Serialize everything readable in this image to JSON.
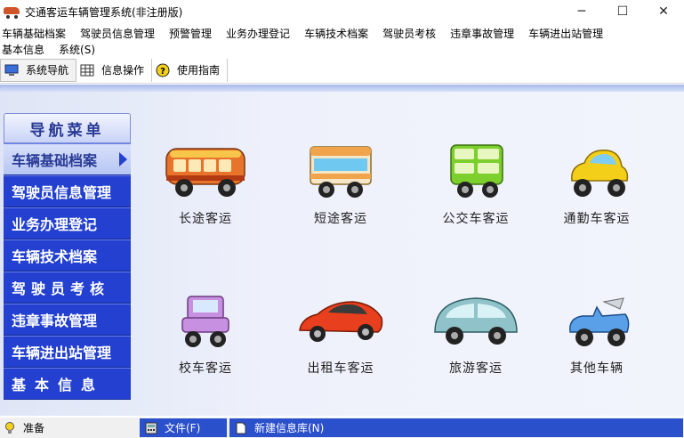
{
  "window": {
    "title": "交通客运车辆管理系统(非注册版)",
    "minimize": "─",
    "maximize": "☐",
    "close": "✕"
  },
  "menu": {
    "row1": [
      "车辆基础档案",
      "驾驶员信息管理",
      "预警管理",
      "业务办理登记",
      "车辆技术档案",
      "驾驶员考核",
      "违章事故管理",
      "车辆进出站管理"
    ],
    "row2": [
      "基本信息",
      "系统(S)"
    ]
  },
  "toolbar": {
    "nav": "系统导航",
    "info": "信息操作",
    "guide": "使用指南"
  },
  "nav": {
    "header": "导航菜单",
    "items": [
      "车辆基础档案",
      "驾驶员信息管理",
      "业务办理登记",
      "车辆技术档案",
      "驾驶员考核",
      "违章事故管理",
      "车辆进出站管理",
      "基本信息"
    ]
  },
  "vehicles": [
    {
      "label": "长途客运",
      "icon": "long-distance-bus-icon",
      "color": "#e8732a"
    },
    {
      "label": "短途客运",
      "icon": "short-distance-bus-icon",
      "color": "#f0a54c"
    },
    {
      "label": "公交车客运",
      "icon": "city-bus-icon",
      "color": "#7ccf2c"
    },
    {
      "label": "通勤车客运",
      "icon": "commuter-car-icon",
      "color": "#f4cf1a"
    },
    {
      "label": "校车客运",
      "icon": "school-car-icon",
      "color": "#c890e0"
    },
    {
      "label": "出租车客运",
      "icon": "taxi-sports-car-icon",
      "color": "#e8401e"
    },
    {
      "label": "旅游客运",
      "icon": "tour-car-icon",
      "color": "#8fc2c9"
    },
    {
      "label": "其他车辆",
      "icon": "convertible-car-icon",
      "color": "#5aa0e8"
    }
  ],
  "status": {
    "ready": "准备",
    "file": "文件(F)",
    "new_db": "新建信息库(N)"
  }
}
